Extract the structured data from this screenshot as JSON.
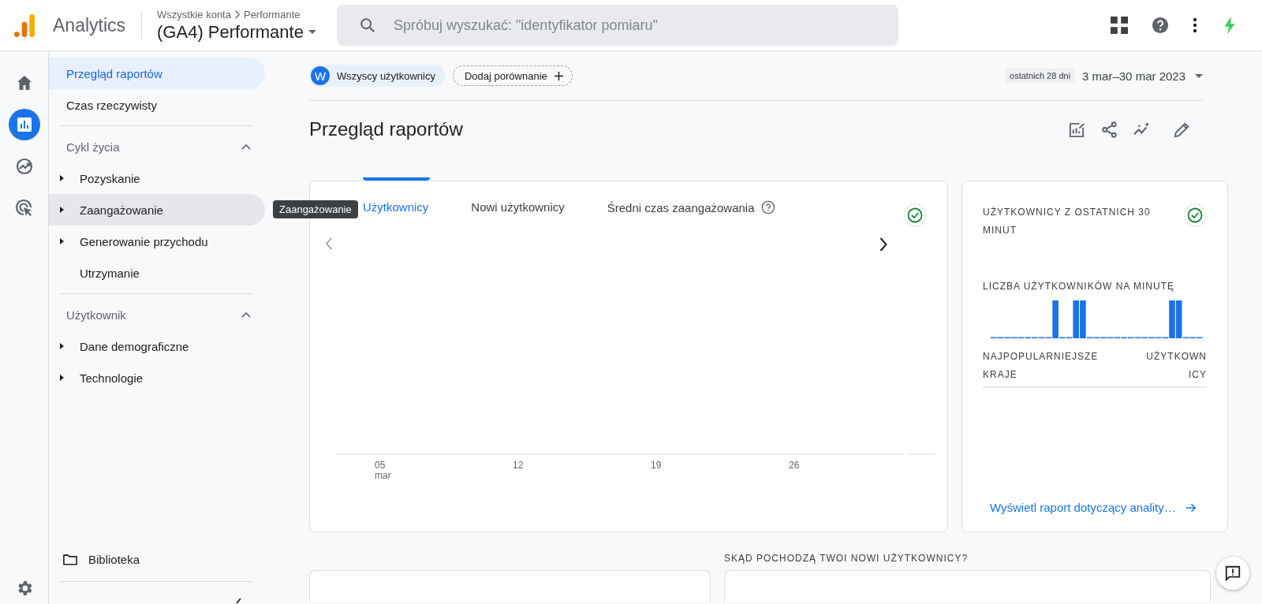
{
  "header": {
    "product": "Analytics",
    "breadcrumb": [
      "Wszystkie konta",
      "Performante"
    ],
    "property": "(GA4) Performante",
    "search": {
      "placeholder": "Spróbuj wyszukać: \"identyfikator pomiaru\""
    }
  },
  "rail": [
    {
      "kind": "home",
      "selected": false
    },
    {
      "kind": "reports",
      "selected": true
    },
    {
      "kind": "explore",
      "selected": false
    },
    {
      "kind": "advertising",
      "selected": false
    }
  ],
  "nav": {
    "top": [
      {
        "label": "Przegląd raportów",
        "selected": true,
        "hovered": false
      },
      {
        "label": "Czas rzeczywisty",
        "selected": false,
        "hovered": false
      }
    ],
    "sections": [
      {
        "title": "Cykl życia",
        "expanded": true,
        "items": [
          {
            "label": "Pozyskanie",
            "has_children": true,
            "selected": false,
            "hovered": false
          },
          {
            "label": "Zaangażowanie",
            "has_children": true,
            "selected": false,
            "hovered": true
          },
          {
            "label": "Generowanie przychodu",
            "has_children": true,
            "selected": false,
            "hovered": false
          },
          {
            "label": "Utrzymanie",
            "has_children": false,
            "selected": false,
            "hovered": false
          }
        ]
      },
      {
        "title": "Użytkownik",
        "expanded": true,
        "items": [
          {
            "label": "Dane demograficzne",
            "has_children": true,
            "selected": false,
            "hovered": false
          },
          {
            "label": "Technologie",
            "has_children": true,
            "selected": false,
            "hovered": false
          }
        ]
      }
    ],
    "library": "Biblioteka"
  },
  "tooltip": "Zaangażowanie",
  "toolbar": {
    "segment": {
      "badge": "W",
      "label": "Wszyscy użytkownicy"
    },
    "compare": "Dodaj porównanie",
    "date_hint": "ostatnich 28 dni",
    "date_range": "3 mar–30 mar 2023"
  },
  "title": "Przegląd raportów",
  "overview": {
    "tabs": [
      {
        "label": "Użytkownicy",
        "selected": true,
        "help": false
      },
      {
        "label": "Nowi użytkownicy",
        "selected": false,
        "help": false
      },
      {
        "label": "Średni czas zaangażowania",
        "selected": false,
        "help": true
      }
    ],
    "x_labels": [
      {
        "day": "05",
        "month": "mar"
      },
      {
        "day": "12"
      },
      {
        "day": "19"
      },
      {
        "day": "26"
      }
    ]
  },
  "realtime": {
    "title": "UŻYTKOWNICY Z OSTATNICH 30 MINUT",
    "chart_title": "LICZBA UŻYTKOWNIKÓW NA MINUTĘ",
    "column_1": "NAJPOPULARNIEJSZE KRAJE",
    "column_2": "UŻYTKOWNICY",
    "link": "Wyświetl raport dotyczący anality…"
  },
  "section_label": "SKĄD POCHODZĄ TWOI NOWI UŻYTKOWNICY?"
}
